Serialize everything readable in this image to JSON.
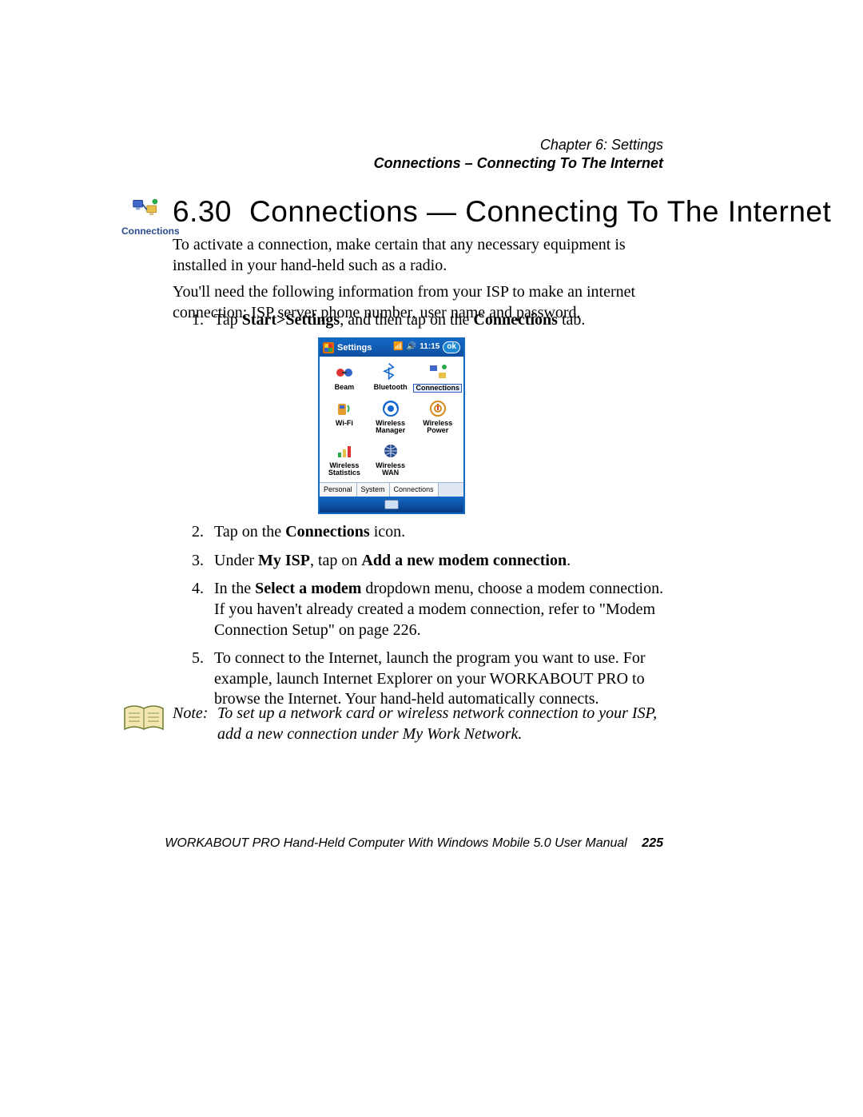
{
  "header": {
    "chapter": "Chapter 6:  Settings",
    "section": "Connections – Connecting To The Internet"
  },
  "section_icon": {
    "name": "connections-icon",
    "label": "Connections"
  },
  "heading": {
    "number": "6.30",
    "title": "Connections — Connecting To The Internet"
  },
  "intro": {
    "p1": "To activate a connection, make certain that any necessary equipment is installed in your hand-held such as a radio.",
    "p2": "You'll need the following information from your ISP to make an internet connection: ISP server phone number, user name and password."
  },
  "steps": {
    "s1_a": "Tap ",
    "s1_b": "Start>Settings",
    "s1_c": ", and then tap on the ",
    "s1_d": "Connections",
    "s1_e": " tab.",
    "s2_a": "Tap on the ",
    "s2_b": "Connections",
    "s2_c": " icon.",
    "s3_a": "Under ",
    "s3_b": "My ISP",
    "s3_c": ", tap on ",
    "s3_d": "Add a new modem connection",
    "s3_e": ".",
    "s4_a": "In the ",
    "s4_b": "Select a modem",
    "s4_c": " dropdown menu, choose a modem connection. If you haven't already created a modem connection, refer to \"Modem Connection Setup\" on page 226.",
    "s5": "To connect to the Internet, launch the program you want to use. For example, launch Internet Explorer on your WORKABOUT PRO to browse the Internet. Your hand-held automatically connects."
  },
  "screenshot": {
    "title": "Settings",
    "time": "11:15",
    "ok": "ok",
    "items": [
      {
        "label": "Beam",
        "icon": "beam-icon"
      },
      {
        "label": "Bluetooth",
        "icon": "bluetooth-icon"
      },
      {
        "label": "Connections",
        "icon": "connections-icon",
        "selected": true
      },
      {
        "label": "Wi-Fi",
        "icon": "wifi-icon"
      },
      {
        "label": "Wireless Manager",
        "icon": "wireless-manager-icon"
      },
      {
        "label": "Wireless Power",
        "icon": "wireless-power-icon"
      },
      {
        "label": "Wireless Statistics",
        "icon": "wireless-stats-icon"
      },
      {
        "label": "Wireless WAN",
        "icon": "wireless-wan-icon"
      }
    ],
    "tabs": [
      "Personal",
      "System",
      "Connections"
    ],
    "active_tab": "Connections"
  },
  "note": {
    "label": "Note:",
    "text": "To set up a network card or wireless network connection to your ISP, add a new connection under My Work Network."
  },
  "footer": {
    "text": "WORKABOUT PRO Hand-Held Computer With Windows Mobile 5.0 User Manual",
    "page": "225"
  }
}
